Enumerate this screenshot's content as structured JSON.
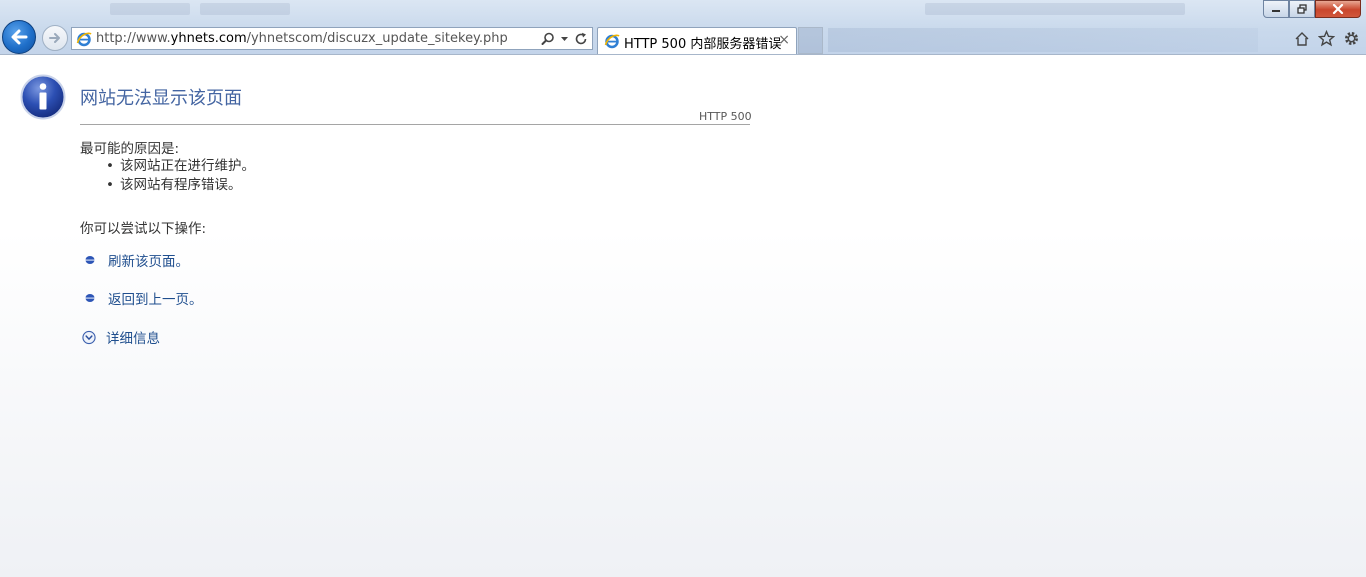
{
  "browser": {
    "url_prefix": "http://www.",
    "url_domain": "yhnets.com",
    "url_path": "/yhnetscom/discuzx_update_sitekey.php",
    "tab_title": "HTTP 500 内部服务器错误",
    "tab_close": "×"
  },
  "page": {
    "title": "网站无法显示该页面",
    "http_code": "HTTP 500",
    "cause_heading": "最可能的原因是:",
    "causes": [
      "该网站正在进行维护。",
      "该网站有程序错误。"
    ],
    "try_heading": "你可以尝试以下操作:",
    "actions": {
      "refresh": "刷新该页面。",
      "back": "返回到上一页。",
      "more_info": "详细信息"
    }
  },
  "colors": {
    "title": "#4465a2",
    "link": "#1f4e8e",
    "text": "#333333",
    "chrome": "#c9d9ec"
  },
  "icons": {
    "back": "back-arrow-icon",
    "forward": "forward-arrow-icon",
    "ie": "ie-logo-icon",
    "search": "search-icon",
    "refresh": "refresh-icon",
    "home": "home-icon",
    "favorites": "star-icon",
    "tools": "gear-icon",
    "info": "info-icon"
  }
}
